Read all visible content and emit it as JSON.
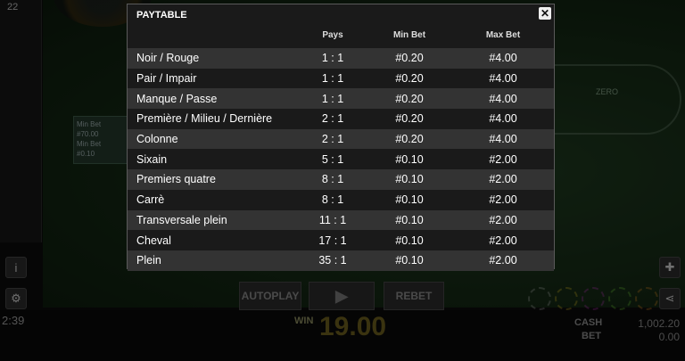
{
  "background": {
    "left_number": "22",
    "min_bet_card": [
      "Min Bet",
      "#70.00",
      "Min Bet",
      "#0.10"
    ],
    "board_label": "ZERO",
    "time": "2:39",
    "autoplay_label": "AUTOPLAY",
    "play_icon": "play-icon",
    "rebet_label": "REBET",
    "win_label": "WIN",
    "win_value": "19.00",
    "cash_label": "CASH",
    "cash_value": "1,002.20",
    "bet_label": "BET",
    "bet_value": "0.00"
  },
  "modal": {
    "title": "PAYTABLE",
    "close_icon": "close-icon",
    "headers": {
      "pays": "Pays",
      "min": "Min Bet",
      "max": "Max Bet"
    },
    "rows": [
      {
        "name": "Noir / Rouge",
        "pays": "1 : 1",
        "min": "#0.20",
        "max": "#4.00"
      },
      {
        "name": "Pair / Impair",
        "pays": "1 : 1",
        "min": "#0.20",
        "max": "#4.00"
      },
      {
        "name": "Manque / Passe",
        "pays": "1 : 1",
        "min": "#0.20",
        "max": "#4.00"
      },
      {
        "name": "Première / Milieu / Dernière",
        "pays": "2 : 1",
        "min": "#0.20",
        "max": "#4.00"
      },
      {
        "name": "Colonne",
        "pays": "2 : 1",
        "min": "#0.20",
        "max": "#4.00"
      },
      {
        "name": "Sixain",
        "pays": "5 : 1",
        "min": "#0.10",
        "max": "#2.00"
      },
      {
        "name": "Premiers quatre",
        "pays": "8 : 1",
        "min": "#0.10",
        "max": "#2.00"
      },
      {
        "name": "Carrè",
        "pays": "8 : 1",
        "min": "#0.10",
        "max": "#2.00"
      },
      {
        "name": "Transversale plein",
        "pays": "11 : 1",
        "min": "#0.10",
        "max": "#2.00"
      },
      {
        "name": "Cheval",
        "pays": "17 : 1",
        "min": "#0.10",
        "max": "#2.00"
      },
      {
        "name": "Plein",
        "pays": "35 : 1",
        "min": "#0.10",
        "max": "#2.00"
      }
    ]
  }
}
